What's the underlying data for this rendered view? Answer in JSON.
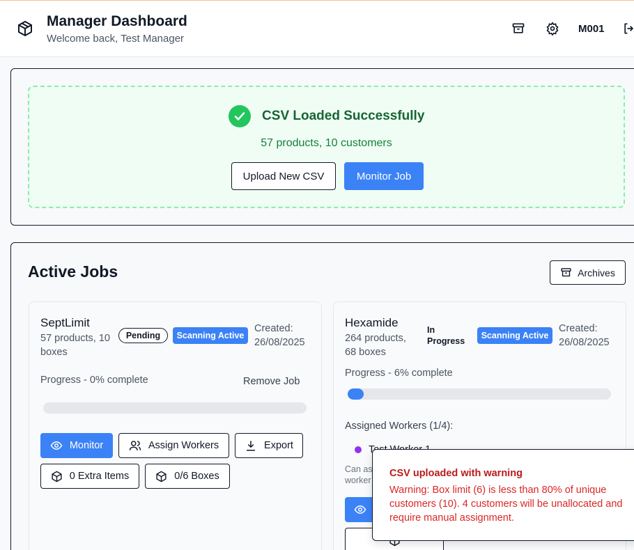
{
  "header": {
    "title": "Manager Dashboard",
    "subtitle": "Welcome back, Test Manager",
    "user_id": "M001",
    "icons": [
      "package-icon",
      "archive-icon",
      "gear-icon",
      "logout-icon"
    ]
  },
  "csv": {
    "status": "CSV Loaded Successfully",
    "summary": "57 products, 10 customers",
    "upload_label": "Upload New CSV",
    "monitor_label": "Monitor Job"
  },
  "jobs": {
    "title": "Active Jobs",
    "archives_label": "Archives",
    "items": [
      {
        "name": "SeptLimit",
        "meta_line1": "57 products, 10",
        "meta_line2": "boxes",
        "status": "Pending",
        "scan": "Scanning Active",
        "created_label": "Created:",
        "created_date": "26/08/2025",
        "progress_label": "Progress - 0% complete",
        "progress": 0,
        "remove_label": "Remove Job",
        "monitor_label": "Monitor",
        "assign_label": "Assign Workers",
        "export_label": "Export",
        "extra_label": "0 Extra Items",
        "boxes_label": "0/6 Boxes"
      },
      {
        "name": "Hexamide",
        "meta_line1": "264 products,",
        "meta_line2": "68 boxes",
        "status_line1": "In",
        "status_line2": "Progress",
        "scan": "Scanning Active",
        "created_label": "Created:",
        "created_date": "26/08/2025",
        "progress_label": "Progress - 6% complete",
        "progress": 0.06,
        "workers_title": "Assigned Workers (1/4):",
        "worker_name": "Test Worker 1",
        "worker_note": "Can as worker"
      }
    ]
  },
  "toast": {
    "title": "CSV uploaded with warning",
    "body": "Warning: Box limit (6) is less than 80% of unique customers (10). 4 customers will be unallocated and require manual assignment."
  },
  "colors": {
    "accent": "#3b82f6",
    "success": "#22c55e",
    "warning_text": "#dc2626",
    "worker_dot": "#9333ea"
  }
}
